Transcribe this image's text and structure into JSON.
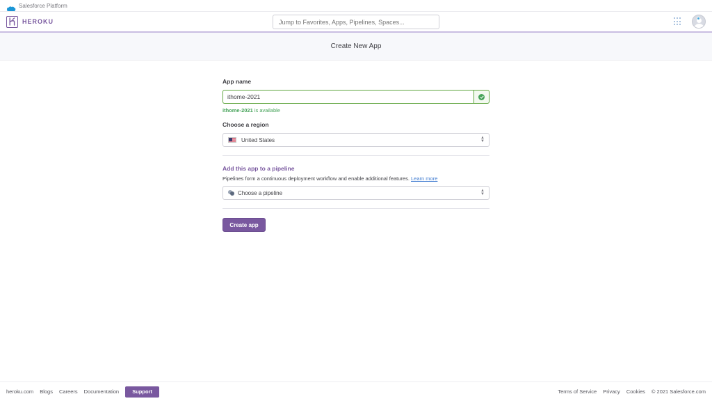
{
  "salesforce_bar": {
    "label": "Salesforce Platform"
  },
  "header": {
    "brand": "HEROKU",
    "search_placeholder": "Jump to Favorites, Apps, Pipelines, Spaces..."
  },
  "page": {
    "title": "Create New App"
  },
  "form": {
    "app_name_label": "App name",
    "app_name_value": "ithome-2021",
    "availability_name": "ithome-2021",
    "availability_suffix": "is available",
    "region_label": "Choose a region",
    "region_value": "United States",
    "pipeline_label": "Add this app to a pipeline",
    "pipeline_desc": "Pipelines form a continuous deployment workflow and enable additional features.",
    "learn_more": "Learn more",
    "pipeline_placeholder": "Choose a pipeline",
    "create_button": "Create app"
  },
  "footer": {
    "left_links": [
      "heroku.com",
      "Blogs",
      "Careers",
      "Documentation"
    ],
    "support": "Support",
    "right_links": [
      "Terms of Service",
      "Privacy",
      "Cookies",
      "© 2021 Salesforce.com"
    ]
  },
  "colors": {
    "brand_purple": "#79589f",
    "success_green": "#47a35a",
    "link_blue": "#3f7bd0"
  }
}
